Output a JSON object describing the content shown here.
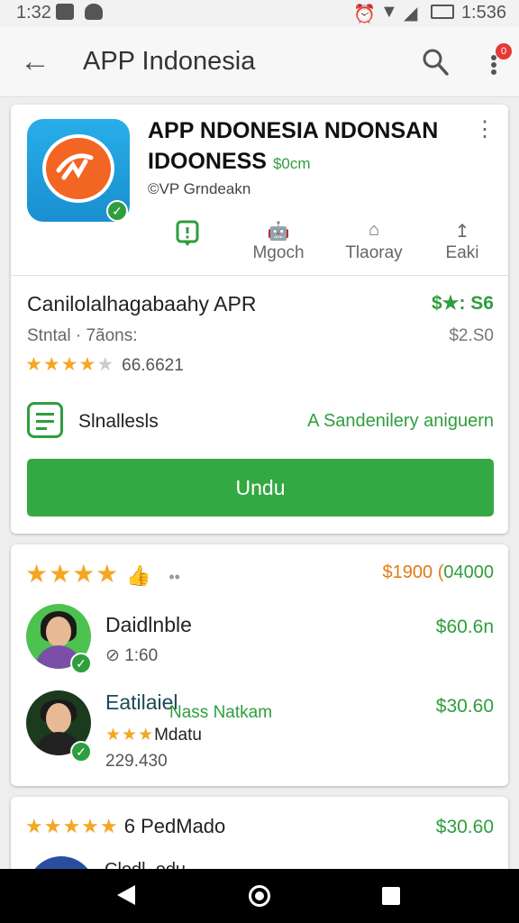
{
  "status_bar": {
    "time": "1:32",
    "right_time": "1:536"
  },
  "app_bar": {
    "title": "APP Indonesia",
    "notification_badge": "0"
  },
  "app": {
    "title_line1": "APP NDONESIA NDONSAN",
    "title_line2": "IDOONESS",
    "title_tag": "$0cm",
    "developer": "©VP Grndeakn",
    "actions": [
      {
        "label": "Mgoch",
        "icon": "robot-icon"
      },
      {
        "label": "Tlaoray",
        "icon": "home-icon"
      },
      {
        "label": "Eaki",
        "icon": "share-icon"
      }
    ]
  },
  "product": {
    "name": "Canilolalhagabaahy APR",
    "price": "$★: S6",
    "subtitle": "Stntal · 7ãons:",
    "subtitle_right": "$2.S0",
    "rating_value": 4,
    "rating_count": "66.6621",
    "feature_label": "Slnallesls",
    "feature_right": "A Sandenilery aniguern",
    "install_button": "Undu"
  },
  "reviews": {
    "top_rating": 4,
    "top_price": "$1900 (",
    "top_price_green": "04000",
    "items": [
      {
        "name": "Daidlnble",
        "sub": "1:60",
        "price": "$60.6n"
      },
      {
        "name": "Eatilaiel",
        "overlay": "Nass Natkam",
        "stars_label": "Mdatu",
        "sub": "229.430",
        "price": "$30.60"
      }
    ]
  },
  "card3": {
    "rating_label": "6 PedMado",
    "price": "$30.60",
    "partial_name": "Clodl..odu"
  },
  "colors": {
    "accent_green": "#34a843",
    "star": "#f5a623",
    "orange": "#f26522"
  }
}
